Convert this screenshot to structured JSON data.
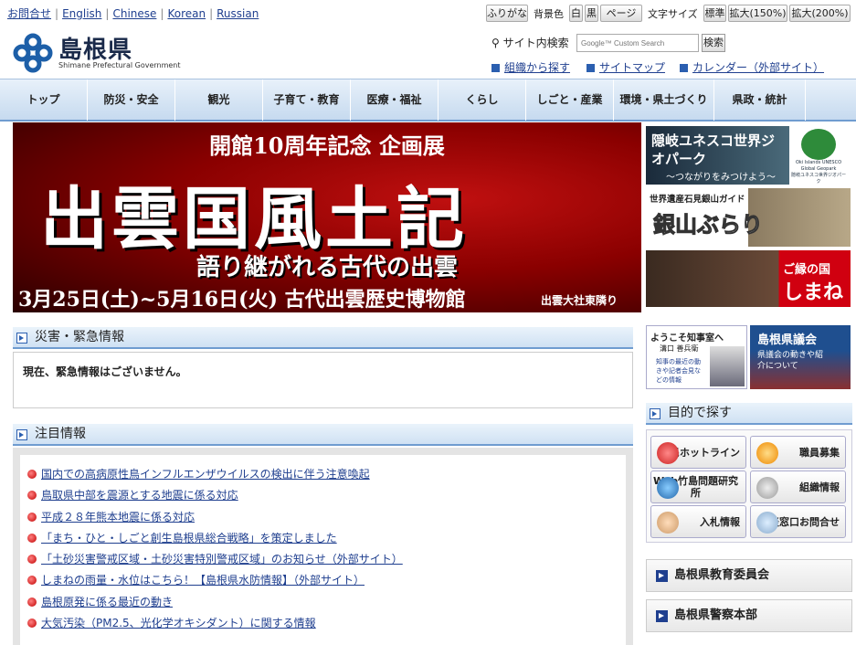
{
  "header": {
    "languages": [
      "お問合せ",
      "English",
      "Chinese",
      "Korean",
      "Russian"
    ],
    "furigana_label": "ふりがな",
    "bg_label": "背景色",
    "bg_options": [
      "白",
      "黒",
      "ページ"
    ],
    "textsize_label": "文字サイズ",
    "textsize_options": [
      "標準",
      "拡大(150%)",
      "拡大(200%)"
    ],
    "logo_title": "島根県",
    "logo_subtitle": "Shimane Prefectural Government",
    "search_label": "サイト内検索",
    "search_placeholder": "Google™ Custom Search",
    "search_button": "検索",
    "links": [
      "組織から探す",
      "サイトマップ",
      "カレンダー（外部サイト）"
    ]
  },
  "nav": [
    "トップ",
    "防災・安全",
    "観光",
    "子育て・教育",
    "医療・福祉",
    "くらし",
    "しごと・産業",
    "環境・県土づくり",
    "県政・統計"
  ],
  "hero": {
    "line1": "開館10周年記念 企画展",
    "line2": "出雲国風土記",
    "line3": "語り継がれる古代の出雲",
    "line4": "3月25日(土)~5月16日(火) 古代出雲歴史博物館",
    "line5": "出雲大社東隣り"
  },
  "banners": {
    "b1_title": "隠岐ユネスコ世界ジオパーク",
    "b1_sub": "～つながりをみつけよう～",
    "b1_logo": "Oki Islands UNESCO Global Geopark",
    "b1_logo_jp": "隠岐ユネスコ世界ジオパーク",
    "b2_title": "世界遺産石見銀山ガイド",
    "b2_logo": "銀山ぶらり",
    "b3_small": "ご縁の国",
    "b3_big": "しまね"
  },
  "emergency": {
    "title": "災害・緊急情報",
    "message": "現在、緊急情報はございません。"
  },
  "notice": {
    "title": "注目情報",
    "items": [
      "国内での高病原性鳥インフルエンザウイルスの検出に伴う注意喚起",
      "鳥取県中部を震源とする地震に係る対応",
      "平成２８年熊本地震に係る対応",
      "「まち・ひと・しごと創生島根県総合戦略」を策定しました",
      "「土砂災害警戒区域・土砂災害特別警戒区域」のお知らせ（外部サイト）",
      "しまねの雨量・水位はこちら！【島根県水防情報】（外部サイト）",
      "島根原発に係る最近の動き",
      "大気汚染（PM2.5、光化学オキシダント）に関する情報"
    ]
  },
  "side": {
    "gov_title": "ようこそ知事室へ",
    "gov_name": "溝口 善兵衛",
    "gov_desc": "知事の最近の動きや記者会見などの情報",
    "assembly_title": "島根県議会",
    "assembly_desc": "県議会の動きや紹介について",
    "search_title": "目的で探す",
    "buttons": [
      "県民ホットライン",
      "職員募集",
      "Web竹島問題研究所",
      "組織情報",
      "入札情報",
      "相談窓口お問合せ"
    ],
    "bars": [
      "島根県教育委員会",
      "島根県警察本部"
    ]
  }
}
